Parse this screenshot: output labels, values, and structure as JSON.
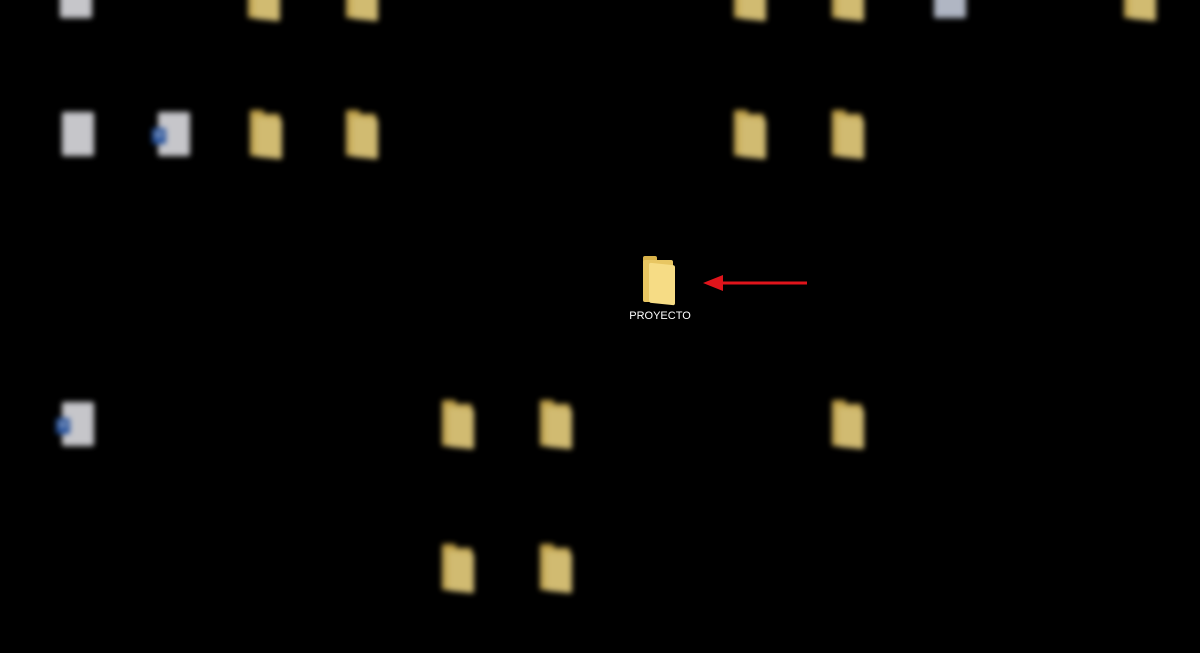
{
  "desktop": {
    "background": "#000000",
    "focused_icon": {
      "label": "PROYECTO",
      "type": "folder"
    },
    "pointer_arrow_color": "#e0141b"
  }
}
